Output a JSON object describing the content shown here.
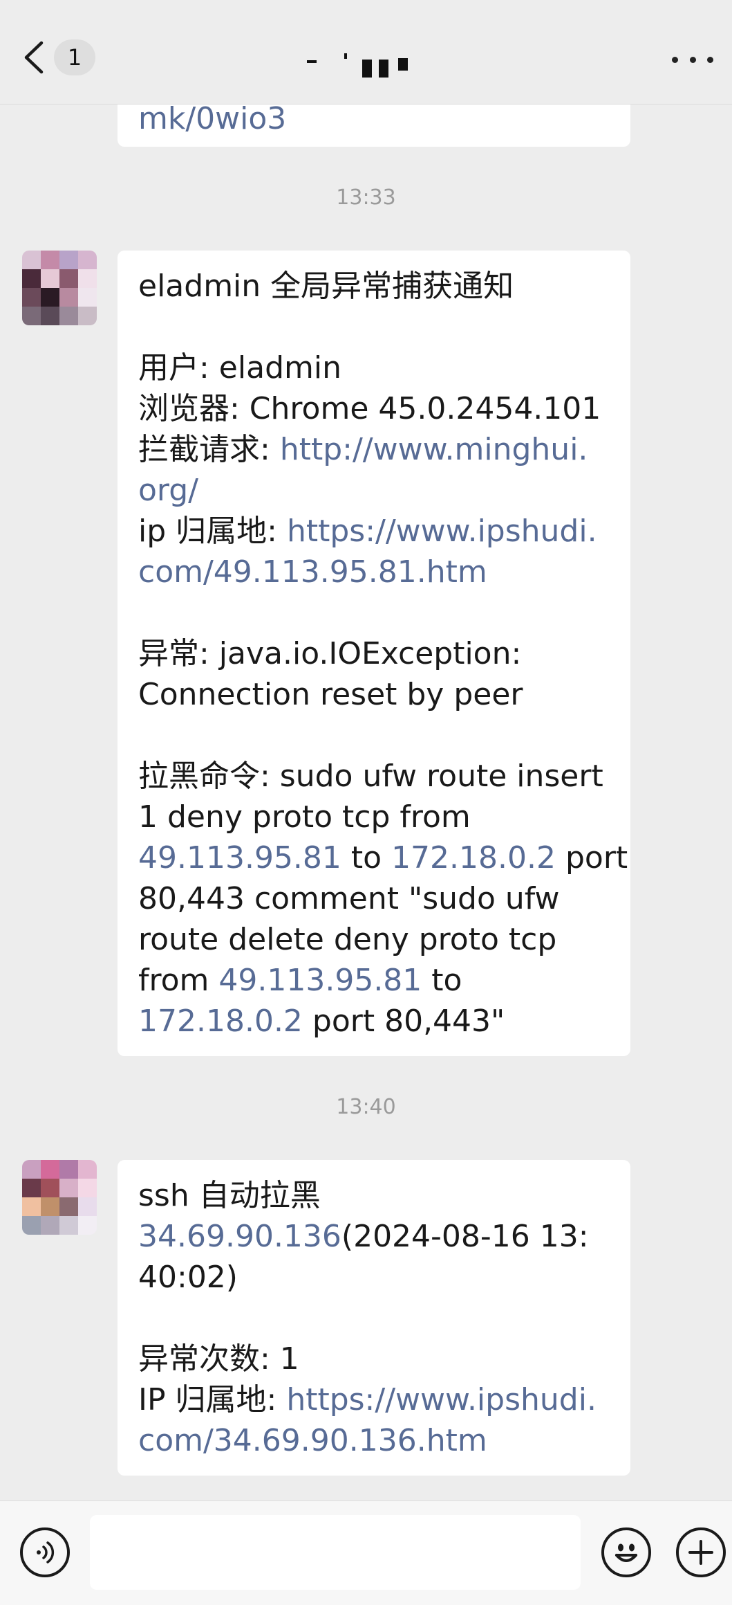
{
  "nav": {
    "unread_count": "1"
  },
  "messages": [
    {
      "time": "13:33",
      "tail_line": [
        {
          "text": "mk/0wio3",
          "link": true
        }
      ]
    },
    {
      "title": "eladmin 全局异常捕获通知",
      "lines": [
        [
          {
            "text": "用户: eladmin"
          }
        ],
        [
          {
            "text": "浏览器: Chrome 45.0.2454.101"
          }
        ],
        [
          {
            "text": "拦截请求: "
          },
          {
            "text": "http://www.minghui.",
            "link": true
          }
        ],
        [
          {
            "text": "org/",
            "link": true
          }
        ],
        [
          {
            "text": "ip 归属地: "
          },
          {
            "text": "https://www.ipshudi.",
            "link": true
          }
        ],
        [
          {
            "text": "com/49.113.95.81.htm",
            "link": true
          }
        ],
        [],
        [
          {
            "text": "异常: java.io.IOException:"
          }
        ],
        [
          {
            "text": "Connection reset by peer"
          }
        ],
        [],
        [
          {
            "text": "拉黑命令: sudo ufw route insert"
          }
        ],
        [
          {
            "text": "1 deny proto tcp from"
          }
        ],
        [
          {
            "text": "49.113.95.81",
            "link": true
          },
          {
            "text": " to "
          },
          {
            "text": "172.18.0.2",
            "link": true
          },
          {
            "text": " port"
          }
        ],
        [
          {
            "text": "80,443 comment \"sudo ufw"
          }
        ],
        [
          {
            "text": "route delete deny proto tcp"
          }
        ],
        [
          {
            "text": "from "
          },
          {
            "text": "49.113.95.81",
            "link": true
          },
          {
            "text": " to"
          }
        ],
        [
          {
            "text": "172.18.0.2",
            "link": true
          },
          {
            "text": " port 80,443\""
          }
        ]
      ]
    },
    {
      "time": "13:40",
      "title": "ssh 自动拉黑",
      "lines": [
        [
          {
            "text": "34.69.90.136",
            "link": true
          },
          {
            "text": "(2024-08-16 13:"
          }
        ],
        [
          {
            "text": "40:02)"
          }
        ],
        [],
        [
          {
            "text": "异常次数: 1"
          }
        ],
        [
          {
            "text": "IP 归属地: "
          },
          {
            "text": "https://www.ipshudi.",
            "link": true
          }
        ],
        [
          {
            "text": "com/34.69.90.136.htm",
            "link": true
          }
        ]
      ]
    }
  ],
  "icons": {
    "back": "chevron-left-icon",
    "more": "more-dots-icon",
    "voice": "voice-icon",
    "emoji": "emoji-icon",
    "plus": "plus-icon"
  },
  "colors": {
    "background": "#ededed",
    "bubble": "#ffffff",
    "link": "#576b95",
    "timestamp": "#9a9a9a"
  }
}
